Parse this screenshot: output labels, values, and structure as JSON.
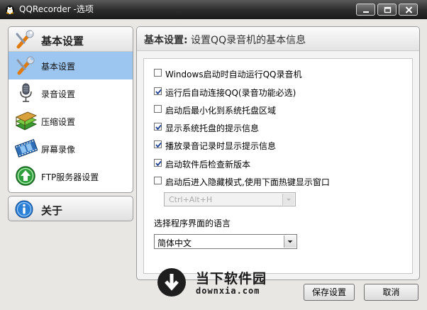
{
  "window": {
    "title": "QQRecorder -选项"
  },
  "sidebar": {
    "header": {
      "label": "基本设置",
      "icon": "wrench-screwdriver-icon"
    },
    "items": [
      {
        "label": "基本设置",
        "icon": "wrench-screwdriver-icon",
        "selected": true
      },
      {
        "label": "录音设置",
        "icon": "microphone-icon",
        "selected": false
      },
      {
        "label": "压缩设置",
        "icon": "book-stack-icon",
        "selected": false
      },
      {
        "label": "屏幕录像",
        "icon": "film-strip-icon",
        "selected": false
      },
      {
        "label": "FTP服务器设置",
        "icon": "green-upload-arrow-icon",
        "selected": false
      }
    ],
    "about": {
      "label": "关于",
      "icon": "info-icon"
    }
  },
  "main": {
    "header_bold": "基本设置:",
    "header_desc": " 设置QQ录音机的基本信息",
    "options": [
      {
        "label": "Windows启动时自动运行QQ录音机",
        "checked": false
      },
      {
        "label": "运行后自动连接QQ(录音功能必选)",
        "checked": true
      },
      {
        "label": "启动后最小化到系统托盘区域",
        "checked": false
      },
      {
        "label": "显示系统托盘的提示信息",
        "checked": true
      },
      {
        "label": "播放录音记录时显示提示信息",
        "checked": true
      },
      {
        "label": "启动软件后检查新版本",
        "checked": true
      },
      {
        "label": "启动后进入隐藏模式,使用下面热键显示窗口",
        "checked": false
      }
    ],
    "hotkey_value": "Ctrl+Alt+H",
    "language_label": "选择程序界面的语言",
    "language_value": "简体中文"
  },
  "watermark": {
    "line1": "当下软件园",
    "line2": "downxia.com"
  },
  "buttons": {
    "save": "保存设置",
    "cancel": "取消"
  },
  "colors": {
    "titlebar": "#2e2e2e",
    "selected_item": "#9cc6f0",
    "check": "#1c3f94"
  }
}
